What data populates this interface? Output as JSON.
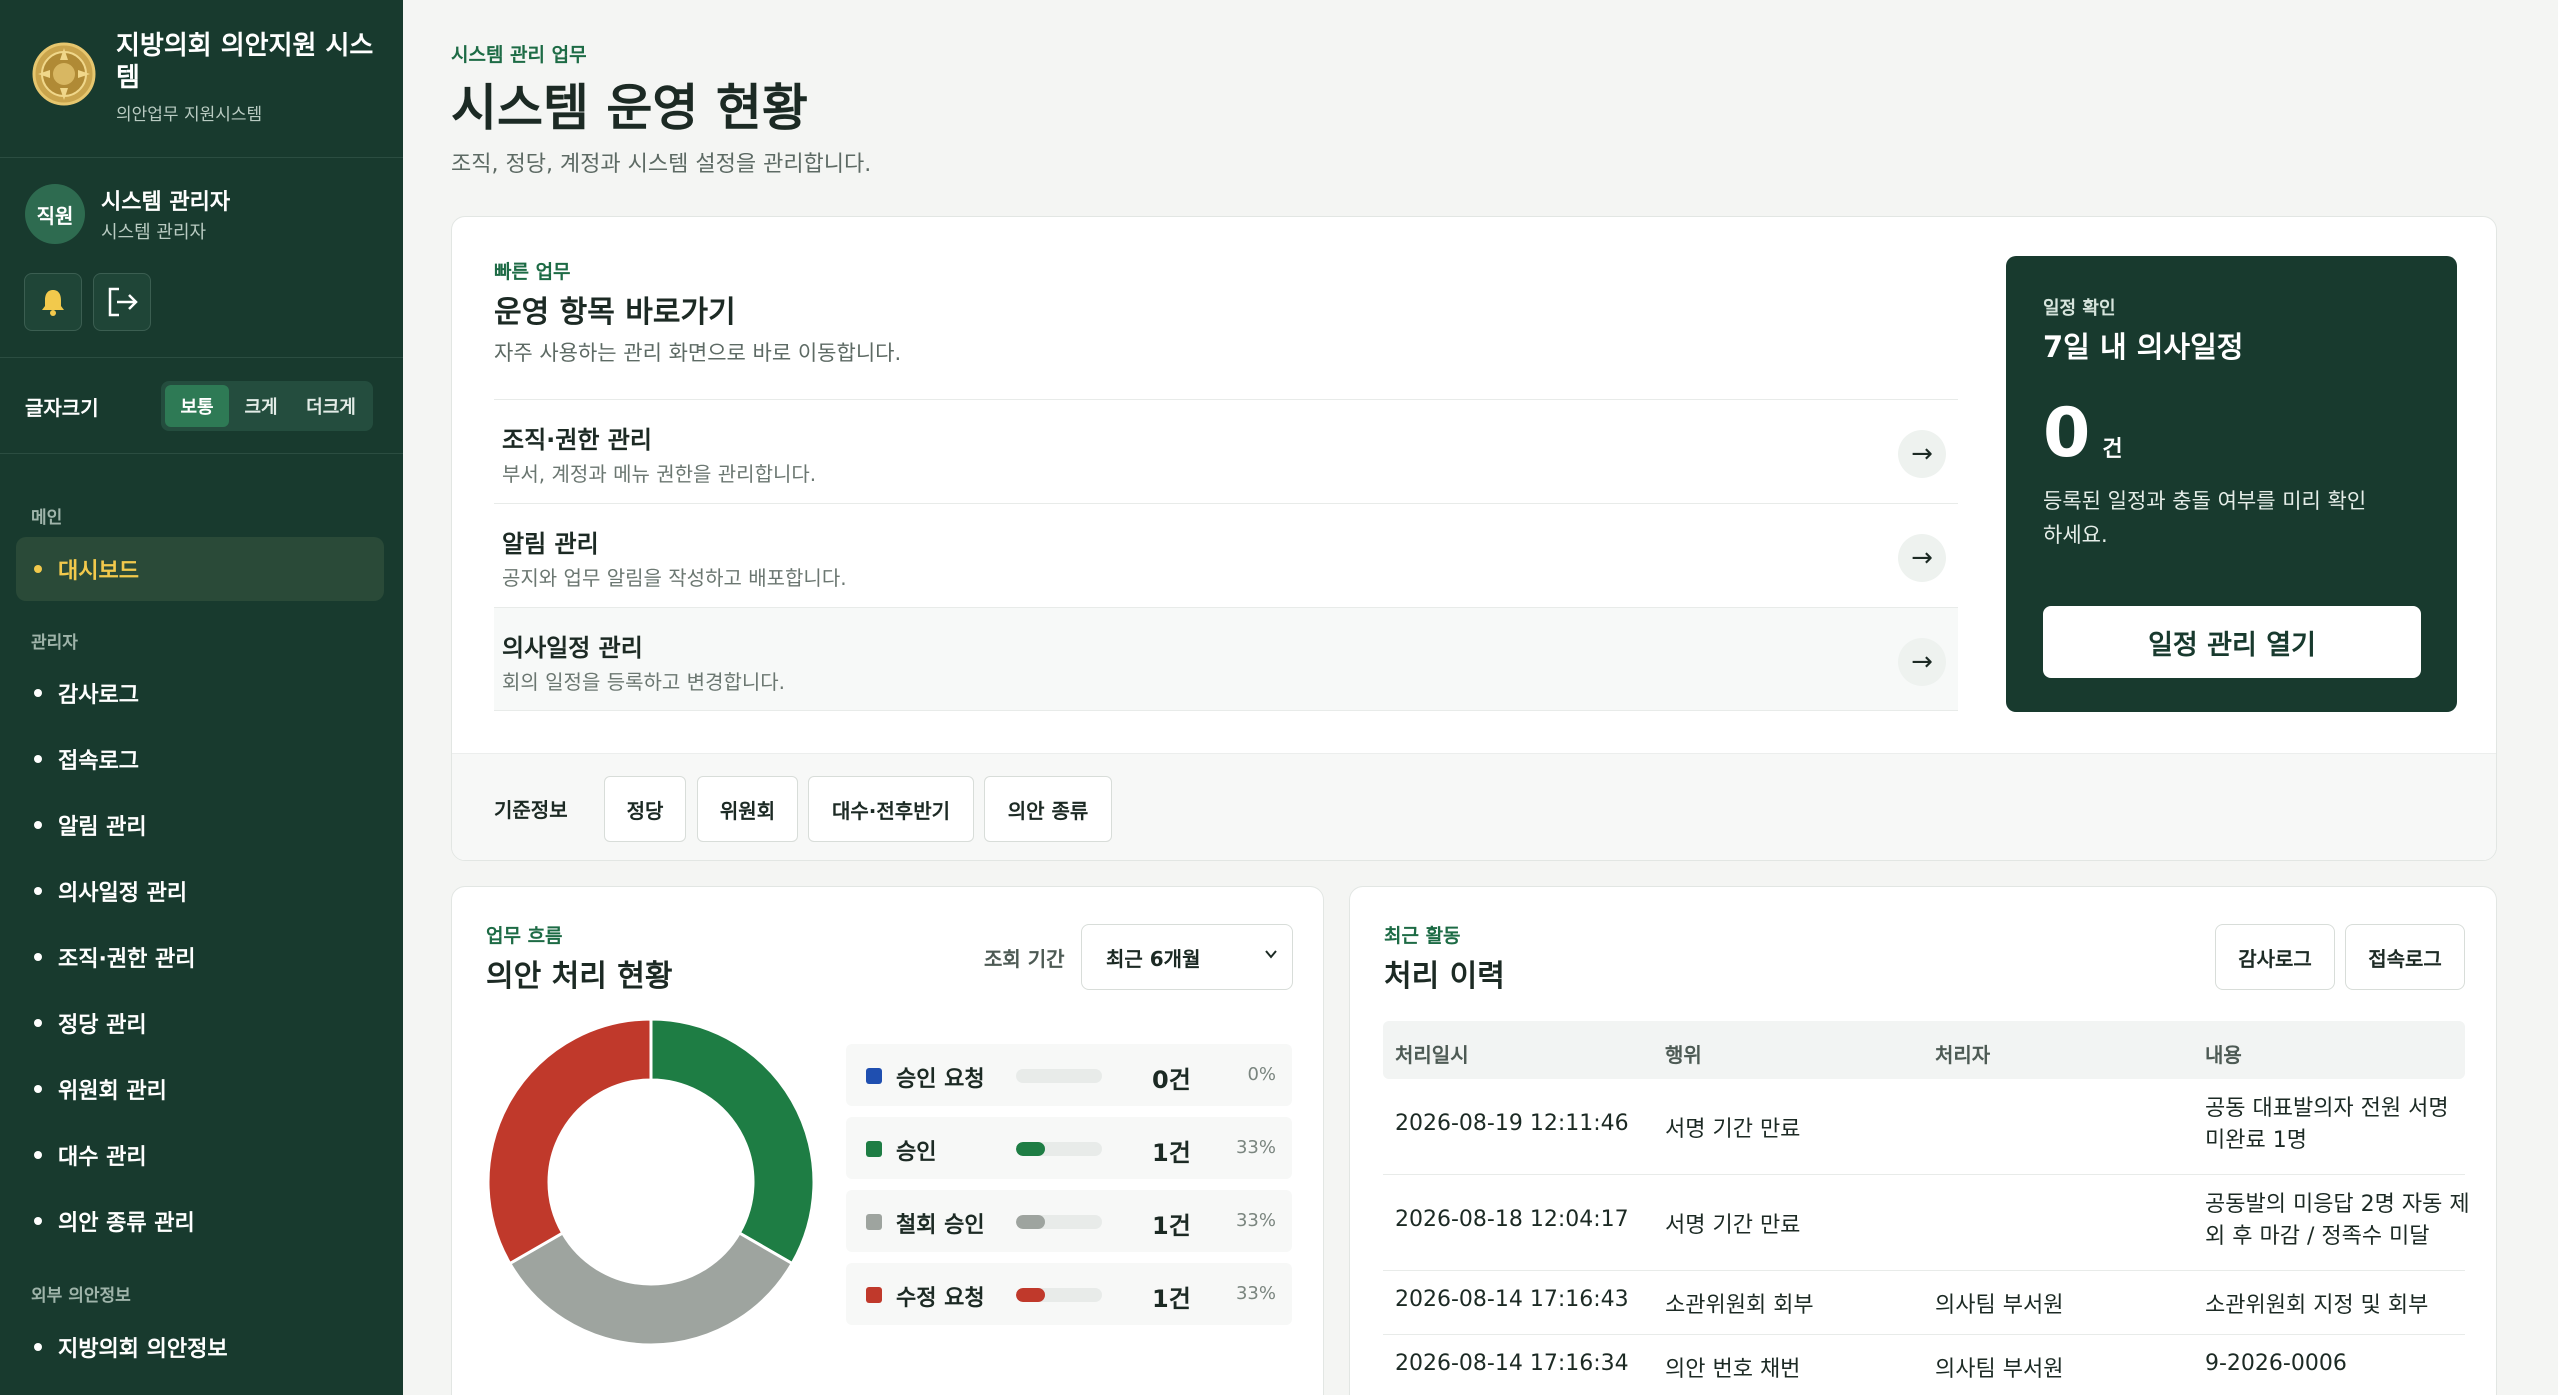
{
  "sidebar": {
    "brand_title": "지방의회 의안지원 시스템",
    "brand_sub": "의안업무 지원시스템",
    "avatar": "직원",
    "user_name": "시스템 관리자",
    "user_role": "시스템 관리자",
    "font_label": "글자크기",
    "font_options": [
      "보통",
      "크게",
      "더크게"
    ],
    "groups": [
      "메인",
      "관리자",
      "외부 의안정보"
    ],
    "main_items": [
      "대시보드"
    ],
    "admin_items": [
      "감사로그",
      "접속로그",
      "알림 관리",
      "의사일정 관리",
      "조직·권한 관리",
      "정당 관리",
      "위원회 관리",
      "대수 관리",
      "의안 종류 관리"
    ],
    "external_items": [
      "지방의회 의안정보"
    ]
  },
  "header": {
    "eyebrow": "시스템 관리 업무",
    "title": "시스템 운영 현황",
    "desc": "조직, 정당, 계정과 시스템 설정을 관리합니다."
  },
  "quick": {
    "eyebrow": "빠른 업무",
    "title": "운영 항목 바로가기",
    "desc": "자주 사용하는 관리 화면으로 바로 이동합니다.",
    "arrow": "→",
    "items": [
      {
        "title": "조직·권한 관리",
        "desc": "부서, 계정과 메뉴 권한을 관리합니다."
      },
      {
        "title": "알림 관리",
        "desc": "공지와 업무 알림을 작성하고 배포합니다."
      },
      {
        "title": "의사일정 관리",
        "desc": "회의 일정을 등록하고 변경합니다."
      }
    ]
  },
  "schedule": {
    "eyebrow": "일정 확인",
    "title": "7일 내 의사일정",
    "count": "0",
    "unit": "건",
    "desc": "등록된 일정과 충돌 여부를 미리 확인하세요.",
    "button": "일정 관리 열기"
  },
  "base_info": {
    "label": "기준정보",
    "chips": [
      "정당",
      "위원회",
      "대수·전후반기",
      "의안 종류"
    ]
  },
  "flow": {
    "eyebrow": "업무 흐름",
    "title": "의안 처리 현황",
    "period_label": "조회 기간",
    "period_value": "최근 6개월"
  },
  "chart_data": {
    "type": "pie",
    "categories": [
      "승인 요청",
      "승인",
      "철회 승인",
      "수정 요청"
    ],
    "values": [
      0,
      1,
      1,
      1
    ],
    "count_labels": [
      "0건",
      "1건",
      "1건",
      "1건"
    ],
    "percent_labels": [
      "0%",
      "33%",
      "33%",
      "33%"
    ],
    "colors": [
      "#1f4fb0",
      "#1e7d44",
      "#9ea49f",
      "#c0392b"
    ]
  },
  "activity": {
    "eyebrow": "최근 활동",
    "title": "처리 이력",
    "buttons": [
      "감사로그",
      "접속로그"
    ],
    "columns": [
      "처리일시",
      "행위",
      "처리자",
      "내용"
    ],
    "rows": [
      [
        "2026-08-19 12:11:46",
        "서명 기간 만료",
        "",
        "공동 대표발의자 전원 서명 미완료 1명"
      ],
      [
        "2026-08-18 12:04:17",
        "서명 기간 만료",
        "",
        "공동발의 미응답 2명 자동 제외 후 마감 / 정족수 미달"
      ],
      [
        "2026-08-14 17:16:43",
        "소관위원회 회부",
        "의사팀 부서원",
        "소관위원회 지정 및 회부"
      ],
      [
        "2026-08-14 17:16:34",
        "의안 번호 채번",
        "의사팀 부서원",
        "9-2026-0006"
      ]
    ]
  }
}
